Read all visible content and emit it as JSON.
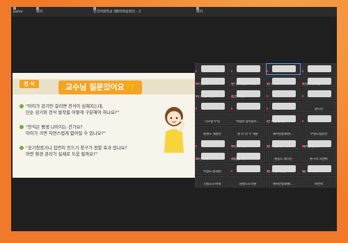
{
  "window": {
    "tabs": [
      "palvo",
      "페이",
      "한국어대학교 제8차화상회의 - 2",
      "페이"
    ],
    "accent": "#f5a323"
  },
  "slide": {
    "tag": "천 식",
    "title": "교수님 질문있어요",
    "title_marks": "??",
    "questions": [
      [
        "\"아이가 감기만 걸리면 천식이 심해지는데,",
        "단순 감기와 천식 발작을 어떻게 구분해야 하나요?\""
      ],
      [
        "\"천식은 평생 나아지는 건가요?",
        "아이가 크면 자연스럽게 없어질 수 있나요?\""
      ],
      [
        "\"공기청정기나 집먼지 진드기 청구가 정말 효과 있나요?",
        "어떤 환경 관리가 실제로 도움 될까요?\""
      ]
    ],
    "character_icon": "cartoon-girl-thinking-icon"
  },
  "participants": [
    {
      "name": "",
      "cam": true
    },
    {
      "name": "",
      "cam": true
    },
    {
      "name": "",
      "cam": true
    },
    {
      "name": "",
      "cam": true
    },
    {
      "name": "우리집 식",
      "cam": true
    },
    {
      "name": "한 명 어린이 소 한",
      "cam": true
    },
    {
      "name": "김 이 서",
      "cam": true
    },
    {
      "name": "한중부 자녀상",
      "cam": true
    },
    {
      "name": "하 나 경 어 린",
      "cam": true
    },
    {
      "name": "삼성 어린",
      "cam": true
    },
    {
      "name": "",
      "cam": true
    },
    {
      "name": "",
      "cam": true
    },
    {
      "name": "",
      "cam": true
    },
    {
      "name": "",
      "cam": true
    },
    {
      "name": "",
      "cam": true
    },
    {
      "name": "윤도현",
      "cam": false
    },
    {
      "name": "디오랭-수현",
      "cam": false
    },
    {
      "name": "박정화 정서청소...",
      "cam": false
    },
    {
      "name": "한 사람 정 한",
      "cam": true
    },
    {
      "name": "",
      "cam": true
    },
    {
      "name": "원영도 해살진",
      "cam": false
    },
    {
      "name": "원 유 한 수 해윤",
      "cam": false
    },
    {
      "name": "새서현정해란(...",
      "cam": false
    },
    {
      "name": "부엉도정준란",
      "cam": false
    },
    {
      "name": "",
      "cam": true
    },
    {
      "name": "보민주 태",
      "cam": true
    },
    {
      "name": "영 우 환 해",
      "cam": true
    },
    {
      "name": "새서한정해주",
      "cam": true
    },
    {
      "name": "보민주 해",
      "cam": true
    },
    {
      "name": "해법을 해",
      "cam": true
    },
    {
      "name": "원동도 레기진",
      "cam": false
    },
    {
      "name": "원구리 시엔야",
      "cam": false
    },
    {
      "name": "우정도-윤재현",
      "cam": false
    },
    {
      "name": "",
      "cam": true
    },
    {
      "name": "명 과 정 해 진",
      "cam": true
    },
    {
      "name": "꽃 이 리 해",
      "cam": true
    },
    {
      "name": "신동도도학해",
      "cam": false
    },
    {
      "name": "남성도도학원",
      "cam": false
    },
    {
      "name": "세서한정해센(...",
      "cam": false
    },
    {
      "name": "아연숙",
      "cam": false
    }
  ]
}
